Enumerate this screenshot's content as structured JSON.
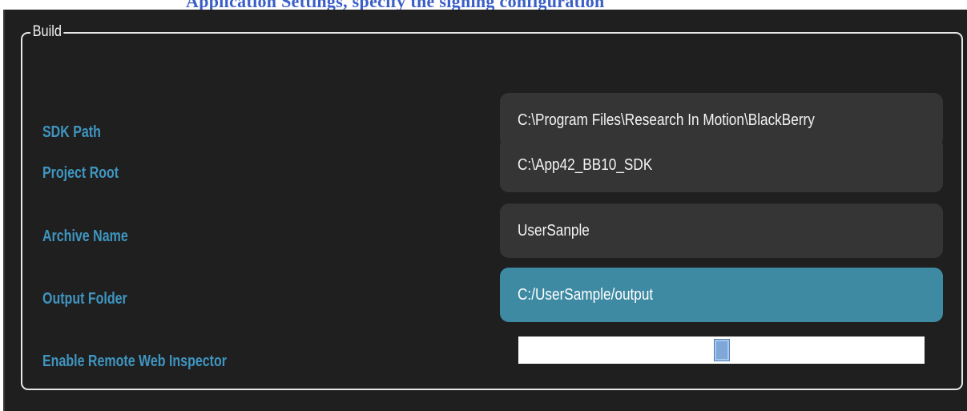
{
  "heading_fragment": "…y ……, …p…y ………g…g…",
  "group": {
    "title": "Build"
  },
  "fields": [
    {
      "label": "SDK Path",
      "value": "C:\\Program Files\\Research In Motion\\BlackBerry"
    },
    {
      "label": "Project Root",
      "value": "C:\\App42_BB10_SDK"
    },
    {
      "label": "Archive Name",
      "value": "UserSanple"
    },
    {
      "label": "Output Folder",
      "value": "C:/UserSample/output"
    }
  ],
  "remote_inspector": {
    "label": "Enable Remote Web Inspector",
    "thumb_position": 0.5
  },
  "colors": {
    "panel_bg": "#1f1f1f",
    "label": "#3f95c0",
    "field_bg": "#353535",
    "field_active_bg": "#3f8aa3",
    "frame": "#e6e6e6"
  }
}
